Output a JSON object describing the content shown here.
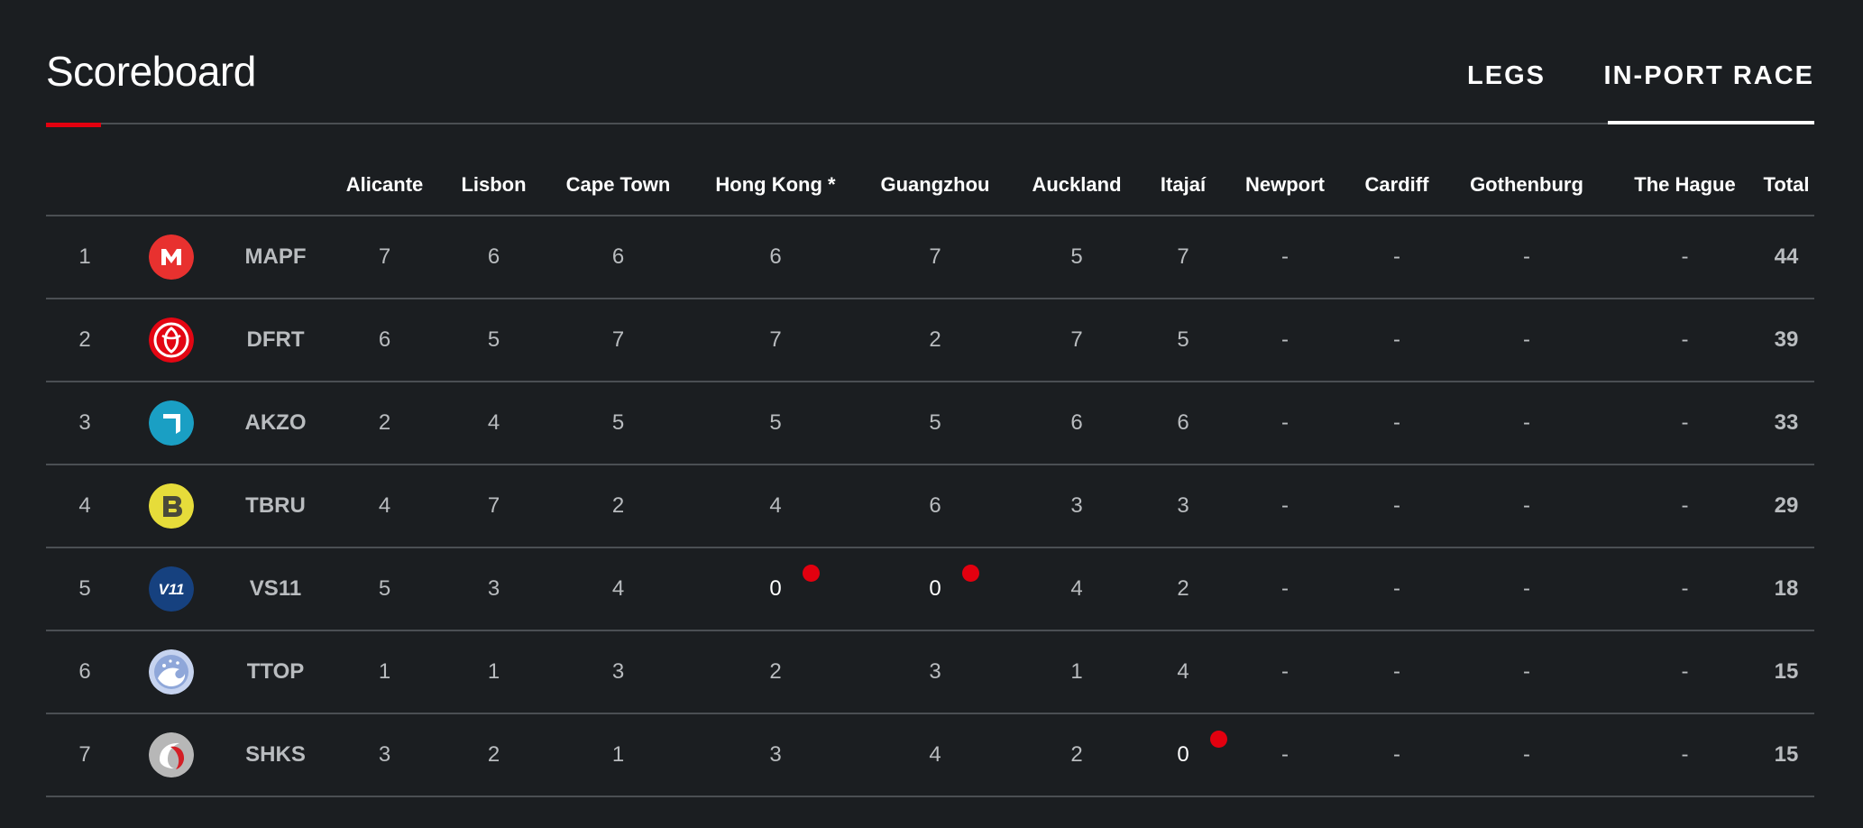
{
  "header": {
    "title": "Scoreboard",
    "tabs": [
      {
        "label": "LEGS",
        "active": false
      },
      {
        "label": "IN-PORT RACE",
        "active": true
      }
    ]
  },
  "colors": {
    "background": "#1b1e21",
    "accent": "#e3000f",
    "divider": "#4b4f53",
    "muted_text": "#b9bcbf"
  },
  "table": {
    "columns": [
      "",
      "",
      "",
      "Alicante",
      "Lisbon",
      "Cape Town",
      "Hong Kong *",
      "Guangzhou",
      "Auckland",
      "Itajaí",
      "Newport",
      "Cardiff",
      "Gothenburg",
      "The Hague",
      "Total"
    ],
    "rows": [
      {
        "rank": "1",
        "team": "MAPF",
        "logo": "mapfre-icon",
        "scores": [
          "7",
          "6",
          "6",
          "6",
          "7",
          "5",
          "7",
          "-",
          "-",
          "-",
          "-"
        ],
        "flags": [
          false,
          false,
          false,
          false,
          false,
          false,
          false,
          false,
          false,
          false,
          false
        ],
        "total": "44"
      },
      {
        "rank": "2",
        "team": "DFRT",
        "logo": "dongfeng-icon",
        "scores": [
          "6",
          "5",
          "7",
          "7",
          "2",
          "7",
          "5",
          "-",
          "-",
          "-",
          "-"
        ],
        "flags": [
          false,
          false,
          false,
          false,
          false,
          false,
          false,
          false,
          false,
          false,
          false
        ],
        "total": "39"
      },
      {
        "rank": "3",
        "team": "AKZO",
        "logo": "akzonobel-icon",
        "scores": [
          "2",
          "4",
          "5",
          "5",
          "5",
          "6",
          "6",
          "-",
          "-",
          "-",
          "-"
        ],
        "flags": [
          false,
          false,
          false,
          false,
          false,
          false,
          false,
          false,
          false,
          false,
          false
        ],
        "total": "33"
      },
      {
        "rank": "4",
        "team": "TBRU",
        "logo": "brunel-icon",
        "scores": [
          "4",
          "7",
          "2",
          "4",
          "6",
          "3",
          "3",
          "-",
          "-",
          "-",
          "-"
        ],
        "flags": [
          false,
          false,
          false,
          false,
          false,
          false,
          false,
          false,
          false,
          false,
          false
        ],
        "total": "29"
      },
      {
        "rank": "5",
        "team": "VS11",
        "logo": "vestas-icon",
        "scores": [
          "5",
          "3",
          "4",
          "0",
          "0",
          "4",
          "2",
          "-",
          "-",
          "-",
          "-"
        ],
        "flags": [
          false,
          false,
          false,
          true,
          true,
          false,
          false,
          false,
          false,
          false,
          false
        ],
        "total": "18"
      },
      {
        "rank": "6",
        "team": "TTOP",
        "logo": "turn-the-tide-icon",
        "scores": [
          "1",
          "1",
          "3",
          "2",
          "3",
          "1",
          "4",
          "-",
          "-",
          "-",
          "-"
        ],
        "flags": [
          false,
          false,
          false,
          false,
          false,
          false,
          false,
          false,
          false,
          false,
          false
        ],
        "total": "15"
      },
      {
        "rank": "7",
        "team": "SHKS",
        "logo": "scallywag-icon",
        "scores": [
          "3",
          "2",
          "1",
          "3",
          "4",
          "2",
          "0",
          "-",
          "-",
          "-",
          "-"
        ],
        "flags": [
          false,
          false,
          false,
          false,
          false,
          false,
          true,
          false,
          false,
          false,
          false
        ],
        "total": "15"
      }
    ]
  },
  "logos": {
    "mapfre-icon": {
      "bg": "#e8312f",
      "glyph": "M"
    },
    "dongfeng-icon": {
      "bg": "#e30613",
      "glyph": ""
    },
    "akzonobel-icon": {
      "bg": "#1a9fc4",
      "glyph": ""
    },
    "brunel-icon": {
      "bg": "#e6dc3a",
      "glyph": "B"
    },
    "vestas-icon": {
      "bg": "#16417f",
      "glyph": "V11"
    },
    "turn-the-tide-icon": {
      "bg": "#8fa7d9",
      "glyph": ""
    },
    "scallywag-icon": {
      "bg": "#b7b7b7",
      "glyph": ""
    }
  }
}
